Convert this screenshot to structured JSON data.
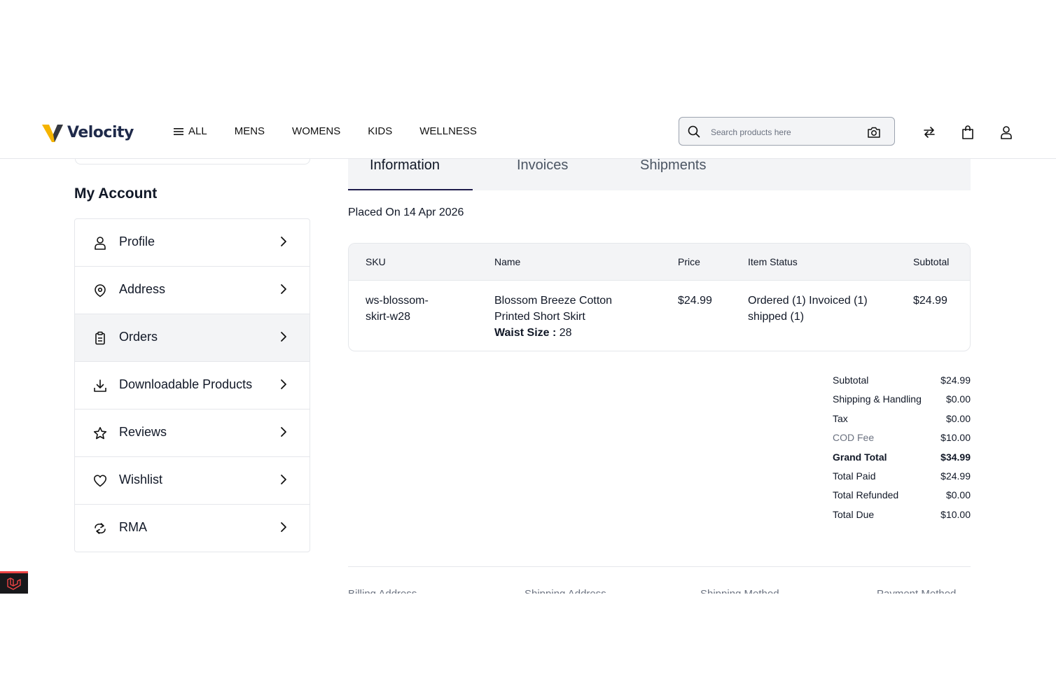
{
  "header": {
    "brand": "Velocity",
    "nav": [
      "ALL",
      "MENS",
      "WOMENS",
      "KIDS",
      "WELLNESS"
    ],
    "search_placeholder": "Search products here"
  },
  "sidebar": {
    "title": "My Account",
    "items": [
      {
        "label": "Profile",
        "icon": "user-icon"
      },
      {
        "label": "Address",
        "icon": "location-pin-icon"
      },
      {
        "label": "Orders",
        "icon": "clipboard-icon",
        "active": true
      },
      {
        "label": "Downloadable Products",
        "icon": "download-icon"
      },
      {
        "label": "Reviews",
        "icon": "star-icon"
      },
      {
        "label": "Wishlist",
        "icon": "heart-icon"
      },
      {
        "label": "RMA",
        "icon": "return-arrows-icon"
      }
    ]
  },
  "tabs": [
    "Information",
    "Invoices",
    "Shipments"
  ],
  "placed_on": "Placed On 14 Apr 2026",
  "items_table": {
    "headers": [
      "SKU",
      "Name",
      "Price",
      "Item Status",
      "Subtotal"
    ],
    "rows": [
      {
        "sku_line1": "ws-blossom-",
        "sku_line2": "skirt-w28",
        "name_line1": "Blossom Breeze Cotton",
        "name_line2": "Printed Short Skirt",
        "attr_label": "Waist Size :",
        "attr_value": "28",
        "price": "$24.99",
        "status_line1": "Ordered (1) Invoiced (1)",
        "status_line2": "shipped (1)",
        "subtotal": "$24.99"
      }
    ]
  },
  "summary": [
    {
      "label": "Subtotal",
      "value": "$24.99"
    },
    {
      "label": "Shipping & Handling",
      "value": "$0.00"
    },
    {
      "label": "Tax",
      "value": "$0.00"
    },
    {
      "label": "COD Fee",
      "value": "$10.00"
    },
    {
      "label": "Grand Total",
      "value": "$34.99"
    },
    {
      "label": "Total Paid",
      "value": "$24.99"
    },
    {
      "label": "Total Refunded",
      "value": "$0.00"
    },
    {
      "label": "Total Due",
      "value": "$10.00"
    }
  ],
  "address_headings": [
    "Billing Address",
    "Shipping Address",
    "Shipping Method",
    "Payment Method"
  ],
  "colors": {
    "accent": "#1e1b4b",
    "brand_yellow": "#f5b400",
    "brand_navy": "#1f2a4a",
    "laravel_red": "#ef4444"
  }
}
